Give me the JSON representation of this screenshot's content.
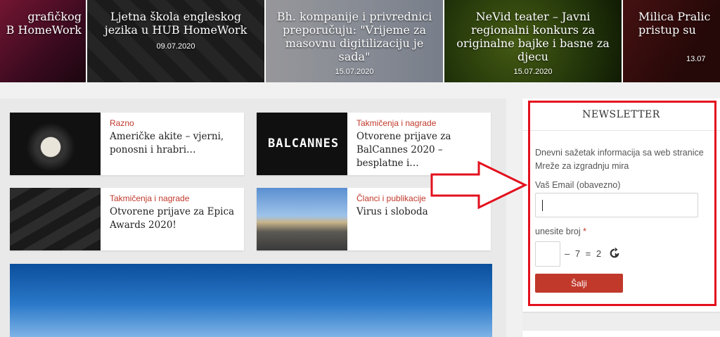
{
  "carousel": [
    {
      "title": "grafičkog\nB HomeWork",
      "date": ""
    },
    {
      "title": "Ljetna škola engleskog jezika u HUB HomeWork",
      "date": "09.07.2020"
    },
    {
      "title": "Bh. kompanije i privrednici preporučuju: \"Vrijeme za masovnu digitilizaciju je sada\"",
      "date": "15.07.2020"
    },
    {
      "title": "NeVid teater – Javni regionalni konkurs za originalne bajke i basne za djecu",
      "date": "15.07.2020"
    },
    {
      "title": "Milica Pralic pristup su",
      "date": "13.07"
    }
  ],
  "posts": [
    {
      "category": "Razno",
      "title": "Američke akite – vjerni, ponosni i hrabri…"
    },
    {
      "category": "Takmičenja i nagrade",
      "title": "Otvorene prijave za BalCannes 2020 – besplatne i…",
      "thumb_text": "BALCANNES"
    },
    {
      "category": "Takmičenja i nagrade",
      "title": "Otvorene prijave za Epica Awards 2020!"
    },
    {
      "category": "Članci i publikacije",
      "title": "Virus i sloboda"
    }
  ],
  "newsletter": {
    "heading": "NEWSLETTER",
    "description": "Dnevni sažetak informacija sa web stranice Mreže za izgradnju mira",
    "email_label": "Vaš Email (obavezno)",
    "email_value": "",
    "captcha_label": "unesite broj",
    "required_mark": "*",
    "captcha_equation": "– 7 = 2",
    "submit_label": "Šalji"
  },
  "colors": {
    "accent": "#c0392b",
    "annotation": "#e3101d"
  },
  "icons": {
    "refresh": "refresh-icon"
  }
}
